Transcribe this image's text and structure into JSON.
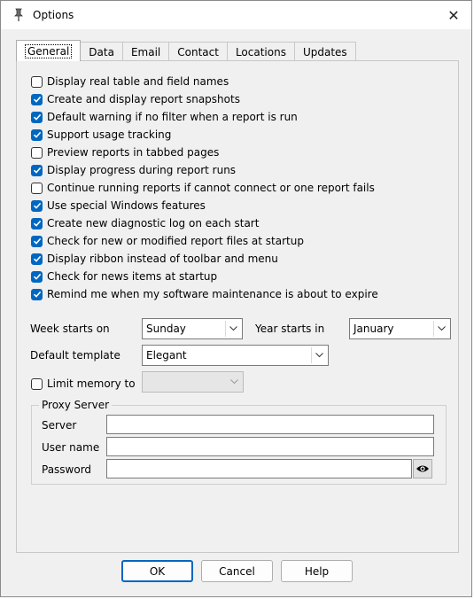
{
  "window": {
    "title": "Options",
    "app_icon": "pushpin-icon",
    "close_glyph": "✕"
  },
  "tabs": [
    {
      "label": "General",
      "active": true
    },
    {
      "label": "Data"
    },
    {
      "label": "Email"
    },
    {
      "label": "Contact"
    },
    {
      "label": "Locations"
    },
    {
      "label": "Updates"
    }
  ],
  "options": [
    {
      "label": "Display real table and field names",
      "checked": false
    },
    {
      "label": "Create and display report snapshots",
      "checked": true
    },
    {
      "label": "Default warning if no filter when a report is run",
      "checked": true
    },
    {
      "label": "Support usage tracking",
      "checked": true
    },
    {
      "label": "Preview reports in tabbed pages",
      "checked": false
    },
    {
      "label": "Display progress during report runs",
      "checked": true
    },
    {
      "label": "Continue running reports if cannot connect or one report fails",
      "checked": false
    },
    {
      "label": "Use special Windows features",
      "checked": true
    },
    {
      "label": "Create new diagnostic log on each start",
      "checked": true
    },
    {
      "label": "Check for new or modified report files at startup",
      "checked": true
    },
    {
      "label": "Display ribbon instead of toolbar and menu",
      "checked": true
    },
    {
      "label": "Check for news items at startup",
      "checked": true
    },
    {
      "label": "Remind me when my software maintenance is about to expire",
      "checked": true
    }
  ],
  "week": {
    "label": "Week starts on",
    "value": "Sunday"
  },
  "year": {
    "label": "Year starts in",
    "value": "January"
  },
  "template": {
    "label": "Default template",
    "value": "Elegant"
  },
  "memory": {
    "label": "Limit memory to",
    "checked": false,
    "value": ""
  },
  "proxy": {
    "title": "Proxy Server",
    "server_label": "Server",
    "username_label": "User name",
    "password_label": "Password",
    "server_value": "",
    "username_value": "",
    "password_value": ""
  },
  "buttons": {
    "ok": "OK",
    "cancel": "Cancel",
    "help": "Help"
  },
  "colors": {
    "accent": "#0067c0",
    "dialog_bg": "#f0f0f0"
  }
}
